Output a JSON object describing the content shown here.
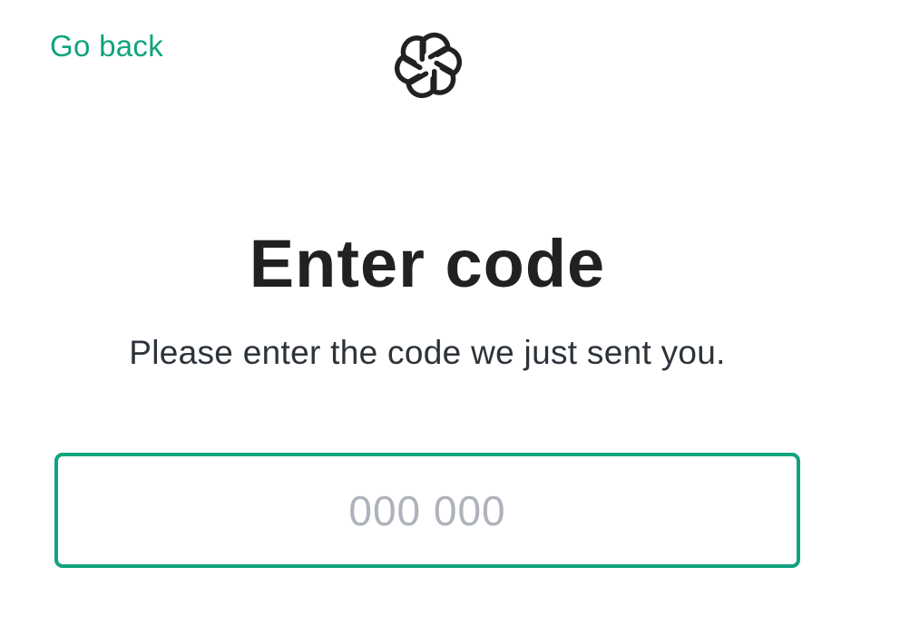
{
  "header": {
    "go_back_label": "Go back",
    "logo_icon": "openai-logo-icon"
  },
  "main": {
    "title": "Enter code",
    "subtitle": "Please enter the code we just sent you.",
    "code_input": {
      "placeholder": "000 000",
      "value": ""
    }
  },
  "colors": {
    "accent": "#10a37f",
    "text": "#202123",
    "placeholder": "#aeb2bb"
  }
}
